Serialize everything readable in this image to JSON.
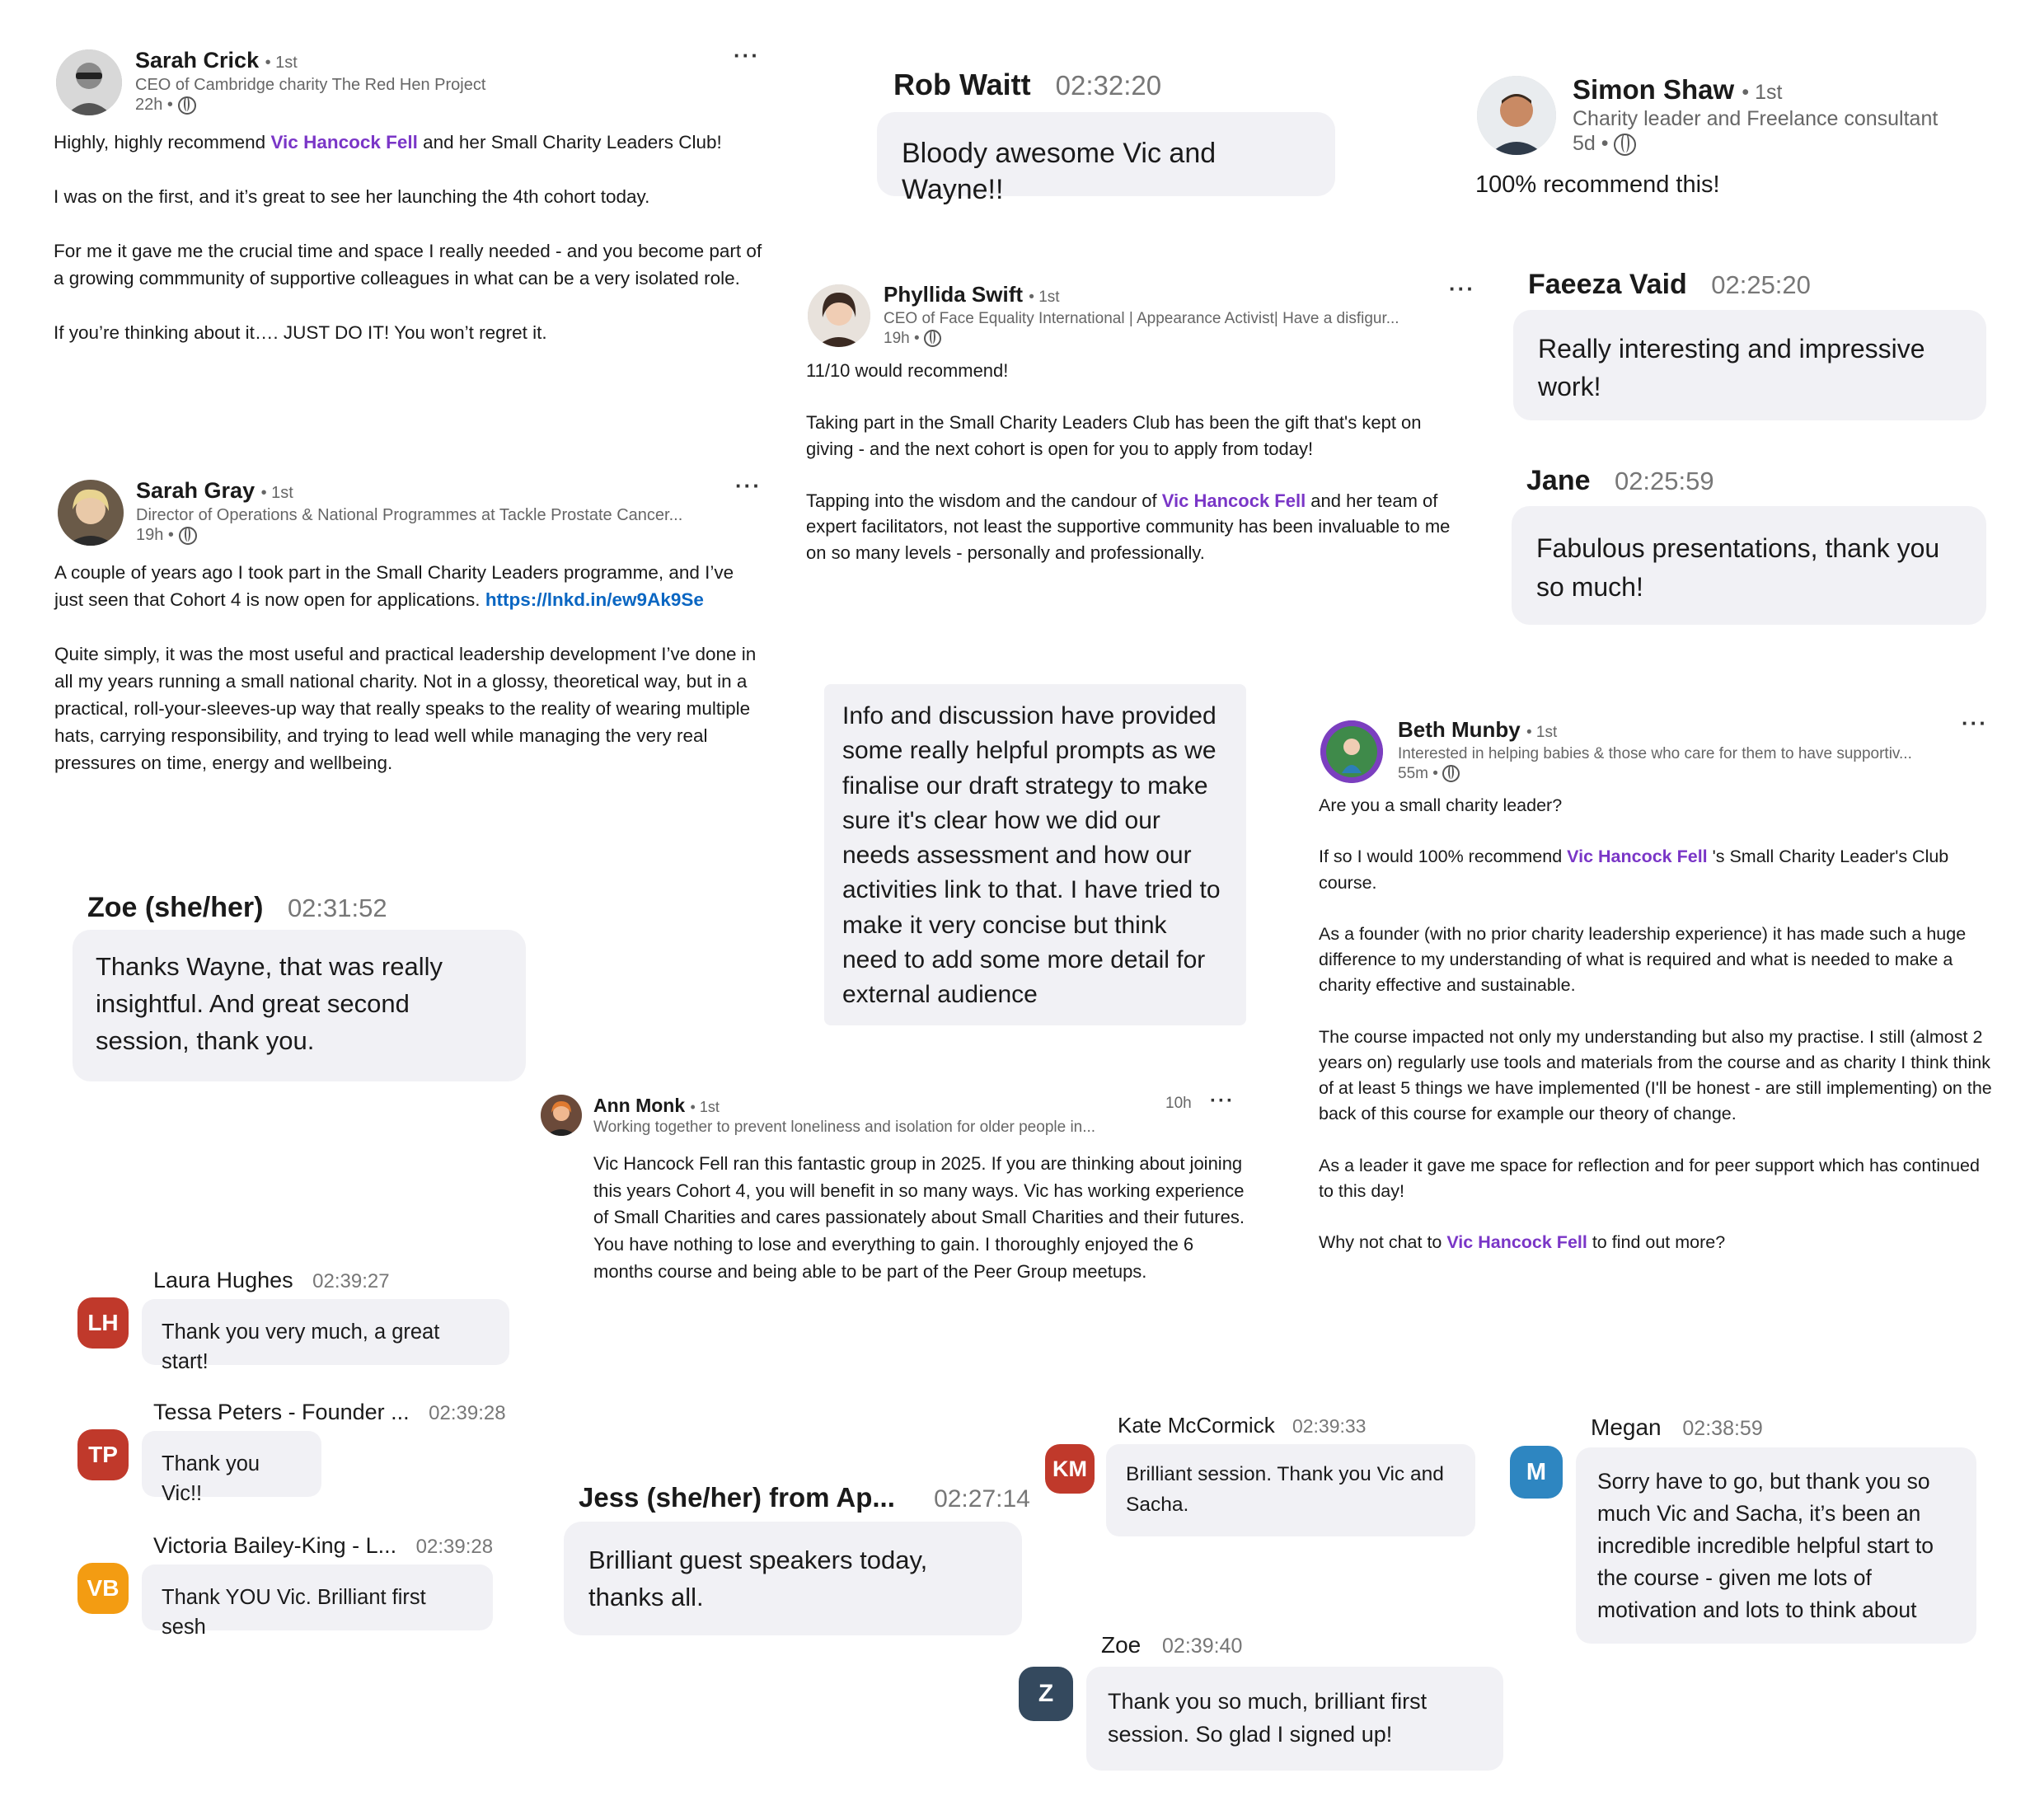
{
  "posts": {
    "sarah_crick": {
      "name": "Sarah Crick",
      "degree": "• 1st",
      "headline": "CEO of Cambridge charity The Red Hen Project",
      "time": "22h •",
      "menu": "···",
      "p1_pre": "Highly, highly recommend ",
      "p1_mention": "Vic Hancock Fell",
      "p1_post": " and her Small Charity Leaders Club!",
      "p2": "I was on the first, and it’s great to see her launching the 4th cohort today.",
      "p3": "For me it gave me the crucial time and space I really needed - and you become part of a growing commmunity of supportive colleagues in what can be a very isolated role.",
      "p4": "If you’re thinking about it…. JUST DO IT! You won’t regret it."
    },
    "sarah_gray": {
      "name": "Sarah Gray",
      "degree": "• 1st",
      "headline": "Director of Operations & National Programmes at Tackle Prostate Cancer...",
      "time": "19h •",
      "menu": "···",
      "p1_pre": "A couple of years ago I took part in the Small Charity Leaders programme, and I’ve just seen that Cohort 4 is now open for applications. ",
      "p1_link": "https://lnkd.in/ew9Ak9Se",
      "p2": "Quite simply, it was the most useful and practical leadership development I’ve done in all my years running a small national charity. Not in a glossy, theoretical way, but in a practical, roll-your-sleeves-up way that really speaks to the reality of wearing multiple hats, carrying responsibility, and trying to lead well while managing the very real pressures on time, energy and wellbeing."
    },
    "phyllida_swift": {
      "name": "Phyllida Swift",
      "degree": "• 1st",
      "headline": "CEO of Face Equality International | Appearance Activist| Have a disfigur...",
      "time": "19h •",
      "menu": "···",
      "p1": "11/10 would recommend!",
      "p2": "Taking part in the Small Charity Leaders Club has been the gift that's kept on giving - and the next cohort is open for you to apply from today!",
      "p3_pre": "Tapping into the wisdom and the candour of ",
      "p3_mention": "Vic Hancock Fell",
      "p3_post": " and her team of expert facilitators, not least the supportive community has been invaluable to me on so many levels - personally and professionally."
    },
    "simon_shaw": {
      "name": "Simon Shaw",
      "degree": "• 1st",
      "headline": "Charity leader and Freelance consultant",
      "time": "5d •",
      "text": "100% recommend this!"
    },
    "beth_munby": {
      "name": "Beth Munby",
      "degree": "• 1st",
      "headline": "Interested in helping babies & those who care for them to have supportiv...",
      "time": "55m •",
      "menu": "···",
      "p1": "Are you a small charity leader?",
      "p2_pre": "If so I would 100% recommend ",
      "p2_mention": "Vic Hancock Fell",
      "p2_post": " 's Small Charity Leader's Club course.",
      "p3": "As a founder (with no prior charity leadership experience) it has made such a huge difference to my understanding of what is required and what is needed to make a charity effective and sustainable.",
      "p4": "The course impacted not only my understanding but also my practise. I still (almost 2 years on) regularly use tools and materials from the course and as charity I think think of at least 5 things we have implemented (I'll be honest - are still implementing) on the back of this course for example our theory of change.",
      "p5": "As a leader it gave me space for reflection and for peer support which has continued to this day!",
      "p6_pre": "Why not chat to ",
      "p6_mention": "Vic Hancock Fell",
      "p6_post": " to find out more?"
    },
    "ann_monk": {
      "name": "Ann Monk",
      "degree": "• 1st",
      "headline": "Working together to prevent loneliness and isolation for older people in...",
      "time": "10h",
      "menu": "···",
      "text": "Vic Hancock Fell ran this fantastic group in 2025. If you are thinking about joining this years Cohort 4, you will benefit in so many ways. Vic has working experience of Small Charities and cares passionately about Small Charities and their futures. You have nothing to lose and everything to gain. I thoroughly enjoyed the 6 months course and being able to be part of the Peer Group meetups."
    }
  },
  "chat_large": [
    {
      "name": "Rob Waitt",
      "time": "02:32:20",
      "message": "Bloody awesome Vic and Wayne!!"
    },
    {
      "name": "Faeeza Vaid",
      "time": "02:25:20",
      "message": "Really interesting and impressive work!"
    },
    {
      "name": "Jane",
      "time": "02:25:59",
      "message": "Fabulous presentations, thank you so much!"
    },
    {
      "name": "Zoe (she/her)",
      "time": "02:31:52",
      "message": "Thanks Wayne, that was really insightful. And great second session, thank you."
    },
    {
      "name": "Jess (she/her) from Ap...",
      "time": "02:27:14",
      "message": "Brilliant guest speakers today, thanks all."
    }
  ],
  "info_bubble": "Info and discussion have provided some really helpful prompts as we finalise our draft strategy to make sure it's clear how we did our needs assessment and how our activities link to that. I have tried to make it very concise but think need to add some more detail for external audience",
  "chat_small": [
    {
      "initials": "LH",
      "color": "#c0392b",
      "name": "Laura Hughes",
      "time": "02:39:27",
      "message": "Thank you very much, a great start!"
    },
    {
      "initials": "TP",
      "color": "#c0392b",
      "name": "Tessa Peters - Founder ...",
      "time": "02:39:28",
      "message": "Thank you Vic!!"
    },
    {
      "initials": "VB",
      "color": "#f39c12",
      "name": "Victoria Bailey-King - L...",
      "time": "02:39:28",
      "message": "Thank YOU Vic. Brilliant first sesh"
    },
    {
      "initials": "KM",
      "color": "#c0392b",
      "name": "Kate McCormick",
      "time": "02:39:33",
      "message": "Brilliant session. Thank you Vic and Sacha."
    },
    {
      "initials": "M",
      "color": "#2e86c1",
      "name": "Megan",
      "time": "02:38:59",
      "message": "Sorry have to go, but thank you so much Vic and Sacha, it’s been an incredible incredible helpful start to the course - given me lots of motivation and lots to think about"
    },
    {
      "initials": "Z",
      "color": "#34495e",
      "name": "Zoe",
      "time": "02:39:40",
      "message": "Thank you so much, brilliant first session. So glad I signed up!"
    }
  ]
}
